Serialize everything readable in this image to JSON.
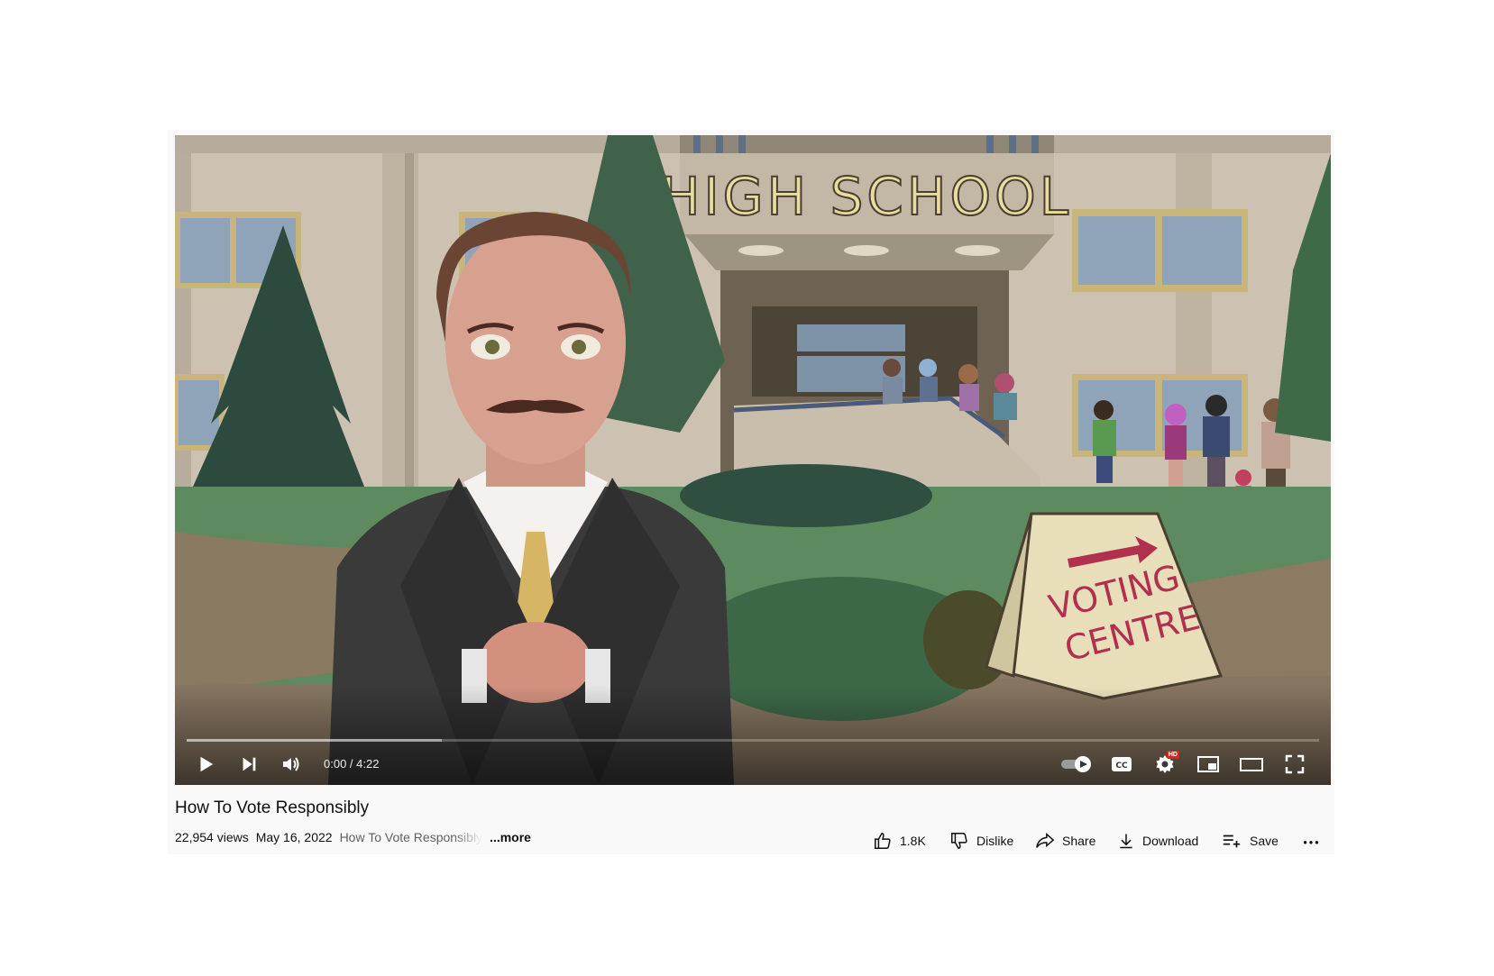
{
  "video": {
    "title": "How To Vote Responsibly",
    "views": "22,954 views",
    "date": "May 16, 2022",
    "description_preview": "How To Vote Responsibly",
    "more_label": "...more",
    "scene_text": {
      "building_sign": "HIGH SCHOOL",
      "board_line1": "VOTING",
      "board_line2": "CENTRE"
    }
  },
  "player": {
    "current_time": "0:00",
    "duration": "4:22",
    "time_display": "0:00 / 4:22",
    "played_fraction": 0,
    "buffered_fraction": 0.225,
    "hd_badge": "HD",
    "icons": [
      "play-icon",
      "next-icon",
      "volume-icon",
      "autoplay-toggle-icon",
      "captions-icon",
      "settings-icon",
      "miniplayer-icon",
      "theater-mode-icon",
      "fullscreen-icon"
    ]
  },
  "actions": {
    "like_count": "1.8K",
    "dislike_label": "Dislike",
    "share_label": "Share",
    "download_label": "Download",
    "save_label": "Save",
    "more_icon": "more-horizontal-icon"
  },
  "colors": {
    "progress_played": "#ff0000",
    "text_primary": "#0f0f0f",
    "text_secondary": "#606060"
  }
}
